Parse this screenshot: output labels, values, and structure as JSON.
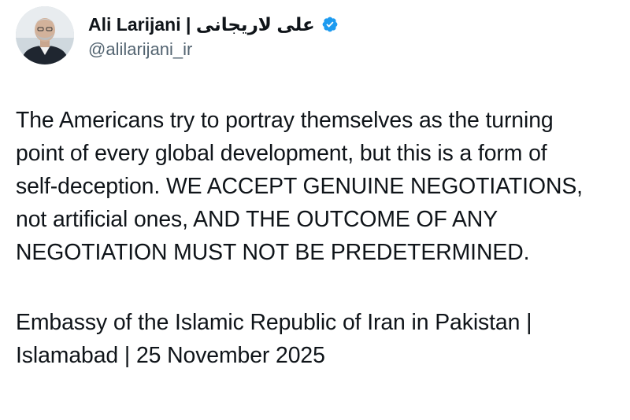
{
  "author": {
    "display_name": "Ali Larijani | علی لاریجانی",
    "handle": "@alilarijani_ir",
    "verified_icon": "verified-badge-icon",
    "verified_color": "#1d9bf0"
  },
  "post": {
    "paragraph_1": "The Americans try to portray themselves as the turning\npoint of every global development, but this is a form of\nself-deception. WE ACCEPT GENUINE NEGOTIATIONS,\nnot artificial ones, AND THE OUTCOME OF ANY\nNEGOTIATION MUST NOT BE PREDETERMINED.",
    "paragraph_2": "Embassy of the Islamic Republic of Iran in Pakistan |\nIslamabad | 25 November 2025"
  },
  "colors": {
    "text": "#0f1419",
    "secondary_text": "#536471",
    "background": "#ffffff"
  }
}
